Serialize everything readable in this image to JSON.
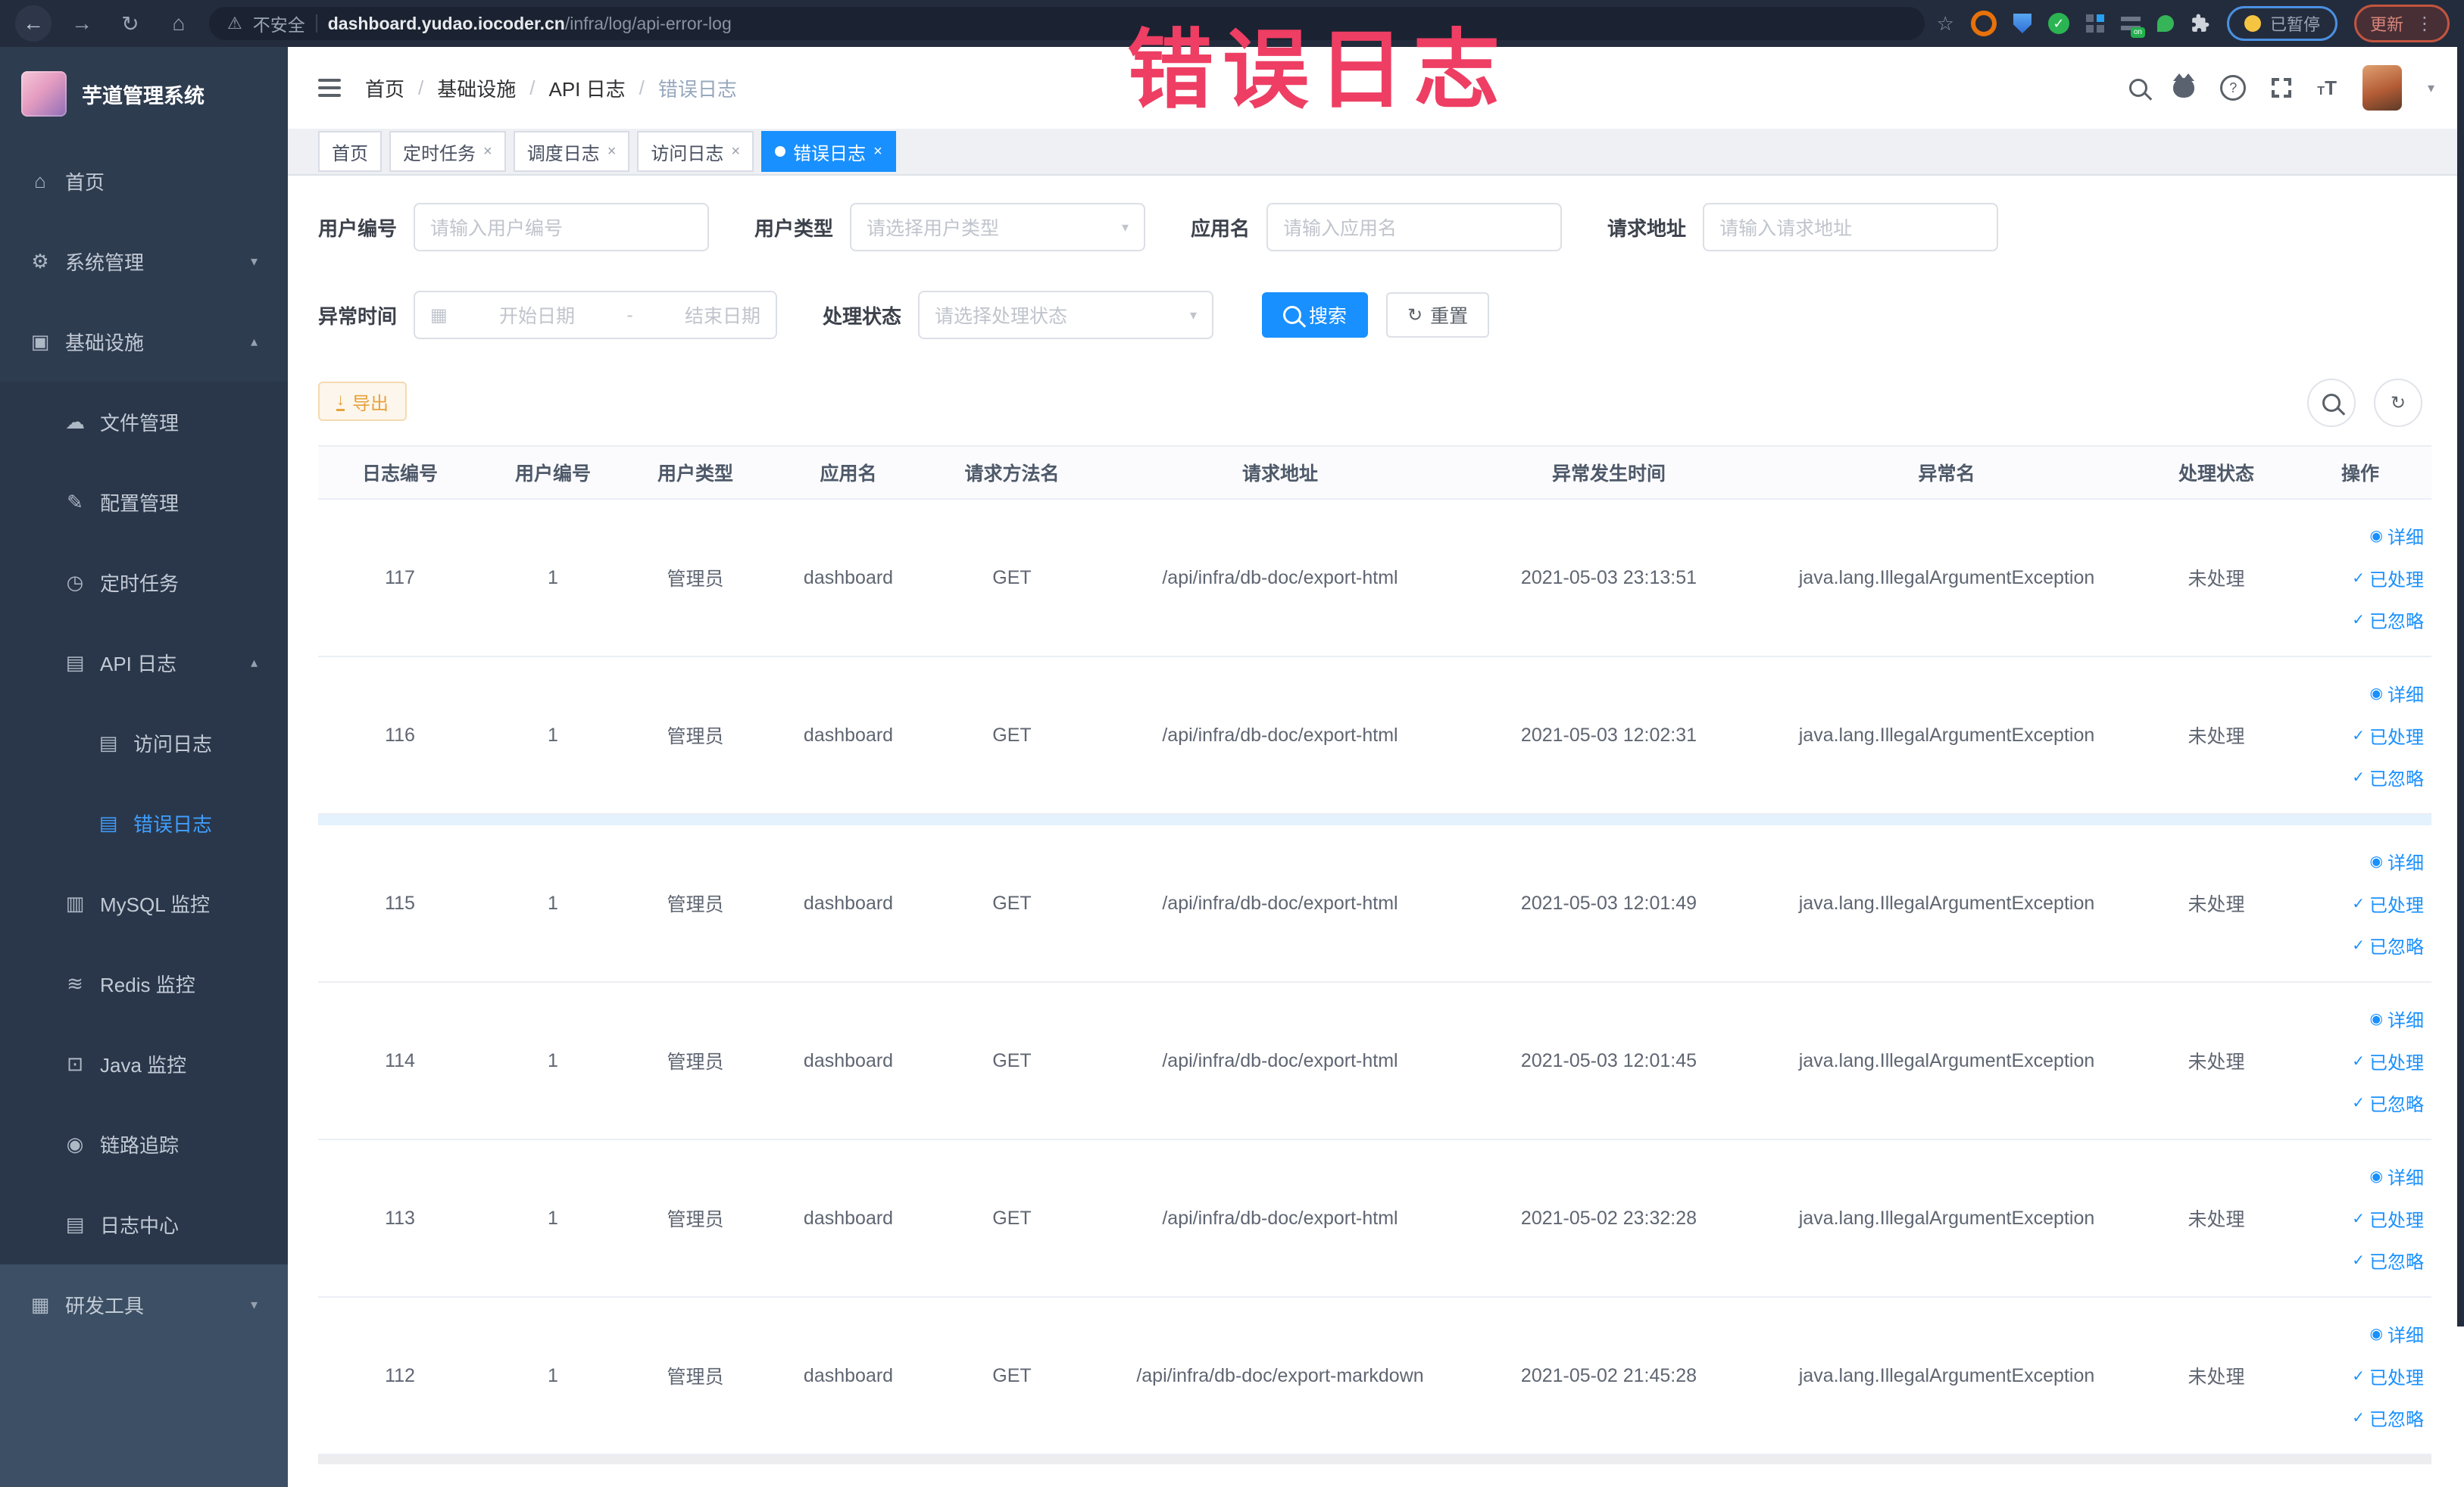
{
  "browser": {
    "security_label": "不安全",
    "url_domain": "dashboard.yudao.iocoder.cn",
    "url_path": "/infra/log/api-error-log",
    "paused_label": "已暂停",
    "update_label": "更新",
    "icons": [
      "back",
      "forward",
      "reload",
      "home",
      "warning",
      "star",
      "extension-orange-ring",
      "extension-shield",
      "extension-green-check",
      "extension-grid",
      "extension-on-badge",
      "extension-leaf",
      "extensions-puzzle",
      "kebab-menu"
    ]
  },
  "overlay": {
    "text": "错误日志",
    "color": "#ee3e63"
  },
  "sidebar": {
    "title": "芋道管理系统",
    "items": [
      {
        "key": "home",
        "label": "首页",
        "icon": "home",
        "level": 0
      },
      {
        "key": "system",
        "label": "系统管理",
        "icon": "gear",
        "level": 0,
        "chevron": "down"
      },
      {
        "key": "infra",
        "label": "基础设施",
        "icon": "monitor",
        "level": 0,
        "chevron": "up"
      },
      {
        "key": "file",
        "label": "文件管理",
        "icon": "cloud",
        "level": 1
      },
      {
        "key": "config",
        "label": "配置管理",
        "icon": "edit",
        "level": 1
      },
      {
        "key": "job",
        "label": "定时任务",
        "icon": "clock",
        "level": 1
      },
      {
        "key": "api-log",
        "label": "API 日志",
        "icon": "log",
        "level": 1,
        "chevron": "up"
      },
      {
        "key": "access-log",
        "label": "访问日志",
        "icon": "log",
        "level": 2
      },
      {
        "key": "error-log",
        "label": "错误日志",
        "icon": "log",
        "level": 2,
        "active": true
      },
      {
        "key": "mysql",
        "label": "MySQL 监控",
        "icon": "chart",
        "level": 1
      },
      {
        "key": "redis",
        "label": "Redis 监控",
        "icon": "redis",
        "level": 1
      },
      {
        "key": "java",
        "label": "Java 监控",
        "icon": "java",
        "level": 1
      },
      {
        "key": "trace",
        "label": "链路追踪",
        "icon": "eye",
        "level": 1
      },
      {
        "key": "log-center",
        "label": "日志中心",
        "icon": "log",
        "level": 1
      },
      {
        "key": "dev-tools",
        "label": "研发工具",
        "icon": "tool",
        "level": 0,
        "chevron": "down",
        "section": "bottom"
      }
    ]
  },
  "header": {
    "breadcrumb": [
      "首页",
      "基础设施",
      "API 日志",
      "错误日志"
    ],
    "icons": [
      "search",
      "github",
      "help",
      "fullscreen",
      "font-size",
      "avatar",
      "caret-down"
    ]
  },
  "tabs": [
    {
      "label": "首页",
      "closable": false,
      "active": false
    },
    {
      "label": "定时任务",
      "closable": true,
      "active": false
    },
    {
      "label": "调度日志",
      "closable": true,
      "active": false
    },
    {
      "label": "访问日志",
      "closable": true,
      "active": false
    },
    {
      "label": "错误日志",
      "closable": true,
      "active": true
    }
  ],
  "filters": {
    "fields": [
      {
        "row": 1,
        "key": "user-id",
        "label": "用户编号",
        "type": "input",
        "placeholder": "请输入用户编号"
      },
      {
        "row": 1,
        "key": "user-type",
        "label": "用户类型",
        "type": "select",
        "placeholder": "请选择用户类型"
      },
      {
        "row": 1,
        "key": "app-name",
        "label": "应用名",
        "type": "input",
        "placeholder": "请输入应用名"
      },
      {
        "row": 1,
        "key": "request-url",
        "label": "请求地址",
        "type": "input",
        "placeholder": "请输入请求地址"
      },
      {
        "row": 2,
        "key": "exception-time",
        "label": "异常时间",
        "type": "daterange",
        "start": "开始日期",
        "separator": "-",
        "end": "结束日期"
      },
      {
        "row": 2,
        "key": "process-status",
        "label": "处理状态",
        "type": "select",
        "placeholder": "请选择处理状态"
      }
    ],
    "search_label": "搜索",
    "reset_label": "重置"
  },
  "toolbar": {
    "export_label": "导出",
    "icons": [
      "search-toggle",
      "refresh"
    ]
  },
  "table": {
    "columns": [
      "日志编号",
      "用户编号",
      "用户类型",
      "应用名",
      "请求方法名",
      "请求地址",
      "异常发生时间",
      "异常名",
      "处理状态",
      "操作"
    ],
    "op_labels": {
      "detail": "详细",
      "processed": "已处理",
      "ignored": "已忽略"
    },
    "rows": [
      {
        "id": "117",
        "user_id": "1",
        "user_type": "管理员",
        "app_name": "dashboard",
        "method": "GET",
        "url": "/api/infra/db-doc/export-html",
        "time": "2021-05-03 23:13:51",
        "exception": "java.lang.IllegalArgumentException",
        "status": "未处理"
      },
      {
        "id": "116",
        "user_id": "1",
        "user_type": "管理员",
        "app_name": "dashboard",
        "method": "GET",
        "url": "/api/infra/db-doc/export-html",
        "time": "2021-05-03 12:02:31",
        "exception": "java.lang.IllegalArgumentException",
        "status": "未处理"
      },
      {
        "id": "115",
        "user_id": "1",
        "user_type": "管理员",
        "app_name": "dashboard",
        "method": "GET",
        "url": "/api/infra/db-doc/export-html",
        "time": "2021-05-03 12:01:49",
        "exception": "java.lang.IllegalArgumentException",
        "status": "未处理",
        "band_before": true
      },
      {
        "id": "114",
        "user_id": "1",
        "user_type": "管理员",
        "app_name": "dashboard",
        "method": "GET",
        "url": "/api/infra/db-doc/export-html",
        "time": "2021-05-03 12:01:45",
        "exception": "java.lang.IllegalArgumentException",
        "status": "未处理"
      },
      {
        "id": "113",
        "user_id": "1",
        "user_type": "管理员",
        "app_name": "dashboard",
        "method": "GET",
        "url": "/api/infra/db-doc/export-html",
        "time": "2021-05-02 23:32:28",
        "exception": "java.lang.IllegalArgumentException",
        "status": "未处理"
      },
      {
        "id": "112",
        "user_id": "1",
        "user_type": "管理员",
        "app_name": "dashboard",
        "method": "GET",
        "url": "/api/infra/db-doc/export-markdown",
        "time": "2021-05-02 21:45:28",
        "exception": "java.lang.IllegalArgumentException",
        "status": "未处理"
      }
    ]
  },
  "colors": {
    "accent": "#1890ff",
    "menu_active": "#409eff",
    "warning": "#e6a23c",
    "sidebar_bg": "#2e3c50"
  }
}
